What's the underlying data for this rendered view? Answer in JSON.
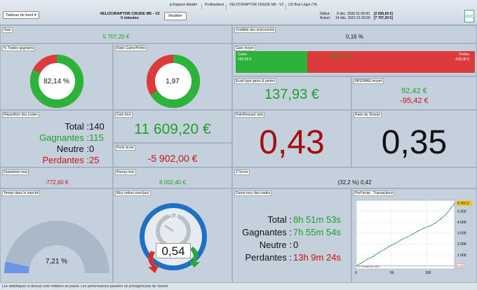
{
  "toolbar": {
    "dashboard": "Tableau de bord ▾",
    "report": "Rapport détaillé",
    "probacktest": "ProBacktest",
    "strategy": "VELOCIRAPTOR CRUDE M5 - V2",
    "instrument": "US Brut Léger (*4)",
    "title1": "VELOCIRAPTOR CRUDE M5 - V2",
    "title2": "5 minutes",
    "modify": "Modifier",
    "start_lbl": "Début :",
    "start_date": "9 déc. 2020 01:00:00",
    "start_val": "[2 000,00 €]",
    "end_lbl": "Actuel :",
    "end_date": "14 déc. 2022 21:20:00",
    "end_val": "[7 707,20 €]",
    "export": "DOC"
  },
  "gain": {
    "label": "Gain",
    "value": "5 707,20 €"
  },
  "volatility": {
    "label": "Volatilité des instruments",
    "value": "0,16 %"
  },
  "win_pct": {
    "label": "% Trades gagnants",
    "value": "82,14 %",
    "fraction": 0.8214
  },
  "ratio": {
    "label": "Ratio Gains/Pertes",
    "value": "1,97",
    "fraction": 0.663
  },
  "avg_gain": {
    "label": "Gain moyen",
    "gains_lbl": "Gains",
    "gains_val": "100,56 €",
    "loss_lbl": "Pertes",
    "loss_val": "-236,08 €",
    "value": "40,77 €",
    "fraction": 0.3
  },
  "stddev": {
    "label": "Ecart type gains & pertes",
    "value": "137,93 €"
  },
  "mfe": {
    "label": "MFE/MAE moyen",
    "pos": "92,42 €",
    "neg": "-95,42 €"
  },
  "trades": {
    "label": "Répartition des trades",
    "total_lbl": "Total : ",
    "total": "140",
    "win_lbl": "Gagnantes : ",
    "win": "115",
    "neutral_lbl": "Neutre : ",
    "neutral": "0",
    "loss_lbl": "Perdantes : ",
    "loss": "25"
  },
  "gross_gain": {
    "label": "Gain brut",
    "value": "11 609,20 €"
  },
  "gross_loss": {
    "label": "Perte brute",
    "value": "-5 902,00 €"
  },
  "rr": {
    "label": "Risk/Reward ratio",
    "value": "0,43"
  },
  "sharpe": {
    "label": "Ratio de Sharpe",
    "value": "0,35"
  },
  "drawdown": {
    "label": "Drawdown max",
    "value": "-772,60 €"
  },
  "runup": {
    "label": "Runup max",
    "value": "6 002,40 €"
  },
  "zscore": {
    "label": "Z-Score",
    "value": "(32,2 %) 0,42"
  },
  "market_time": {
    "label": "Temps dans le marché",
    "value": "7,21 %",
    "fraction": 0.0721
  },
  "orders": {
    "label": "Moy ordres exec/jour",
    "value": "0,54",
    "clock": "24"
  },
  "duration": {
    "label": "Durée moy des trades",
    "total_lbl": "Total : ",
    "total": "8h 51m 53s",
    "win_lbl": "Gagnantes : ",
    "win": "7h 55m 54s",
    "neutral_lbl": "Neutre : ",
    "neutral": "0",
    "loss_lbl": "Perdantes : ",
    "loss": "13h 9m 24s"
  },
  "perf": {
    "label": "Perf brute : Transactions",
    "last": "5 707,2",
    "yticks": [
      "5 000",
      "4 000",
      "3 000",
      "2 000",
      "1 000",
      "0"
    ],
    "xticks": [
      "0",
      "50",
      "100"
    ],
    "zero_val": "0,00",
    "source": "IT-Finance.com"
  },
  "footer": "Les statistiques ci-dessus sont relatives au passé. Les performances passées ne présagent pas de l'avenir.",
  "colors": {
    "green": "#1f9e2a",
    "red": "#dd3b3b",
    "panel": "#c5d0dd"
  },
  "chart_data": {
    "type": "line",
    "title": "Perf brute : Transactions",
    "x": [
      0,
      8,
      16,
      24,
      32,
      40,
      48,
      56,
      64,
      72,
      80,
      88,
      96,
      104,
      112,
      120,
      128,
      134,
      140
    ],
    "values": [
      0,
      280,
      620,
      840,
      1220,
      1480,
      1820,
      2050,
      2380,
      2610,
      2900,
      3180,
      3450,
      3620,
      3900,
      4280,
      4720,
      5250,
      5707.2
    ],
    "xlim": [
      0,
      140
    ],
    "ylim": [
      -300,
      6000
    ],
    "yticks": [
      0,
      1000,
      2000,
      3000,
      4000,
      5000
    ],
    "xticks": [
      0,
      50,
      100
    ]
  }
}
